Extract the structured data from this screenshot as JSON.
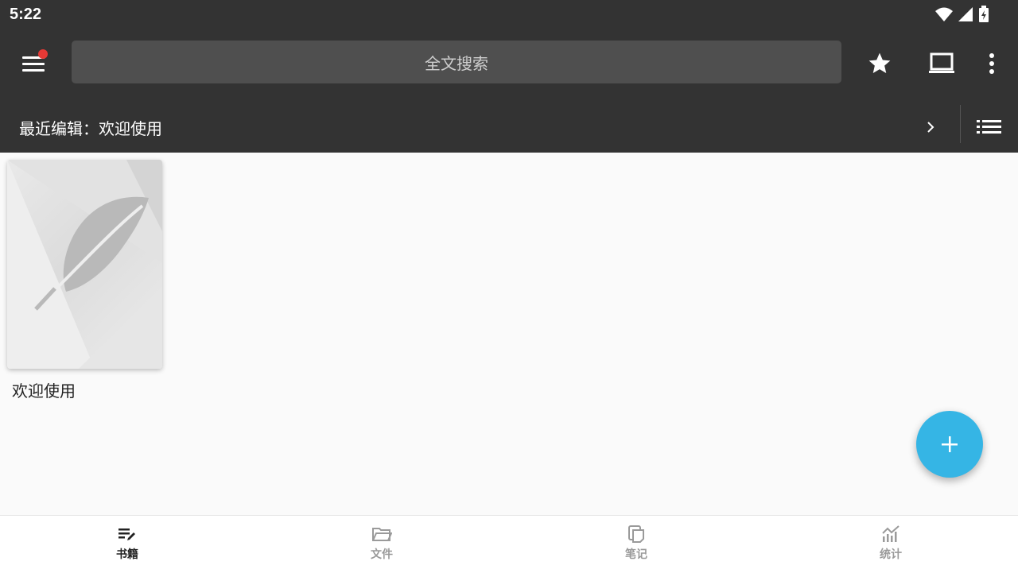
{
  "status_bar": {
    "time": "5:22"
  },
  "toolbar": {
    "menu_icon": "hamburger-menu-icon",
    "notification_dot_color": "#e53935",
    "search_placeholder": "全文搜索",
    "actions": [
      "star-icon",
      "laptop-icon",
      "more-vert-icon"
    ]
  },
  "recent": {
    "label": "最近编辑：欢迎使用"
  },
  "books": [
    {
      "title": "欢迎使用",
      "cover_icon": "feather-icon"
    }
  ],
  "fab": {
    "icon": "plus-icon",
    "color": "#35b5e5"
  },
  "bottom_nav": [
    {
      "label": "书籍",
      "icon": "book-edit-icon",
      "active": true
    },
    {
      "label": "文件",
      "icon": "folder-open-icon",
      "active": false
    },
    {
      "label": "笔记",
      "icon": "notes-icon",
      "active": false
    },
    {
      "label": "统计",
      "icon": "chart-icon",
      "active": false
    }
  ]
}
